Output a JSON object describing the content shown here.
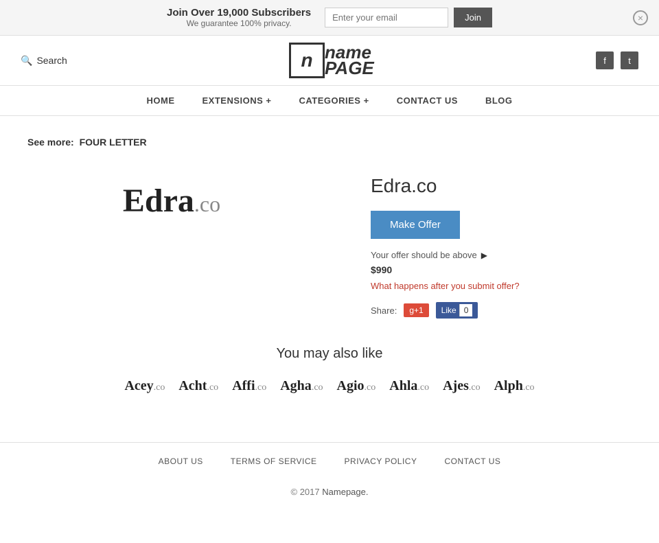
{
  "banner": {
    "main_text": "Join Over 19,000 Subscribers",
    "sub_text": "We guarantee 100% privacy.",
    "email_placeholder": "Enter your email",
    "join_label": "Join",
    "close_icon": "×"
  },
  "header": {
    "search_label": "Search",
    "logo_icon": "n",
    "logo_name": "name",
    "logo_page": "PAGE",
    "facebook_icon": "f",
    "twitter_icon": "t"
  },
  "nav": {
    "items": [
      {
        "label": "HOME",
        "href": "#"
      },
      {
        "label": "EXTENSIONS +",
        "href": "#"
      },
      {
        "label": "CATEGORIES +",
        "href": "#"
      },
      {
        "label": "CONTACT  US",
        "href": "#"
      },
      {
        "label": "BLOG",
        "href": "#"
      }
    ]
  },
  "breadcrumb": {
    "prefix": "See more:",
    "link_label": "FOUR LETTER"
  },
  "domain": {
    "name": "Edra",
    "tld": ".co",
    "full": "Edra.co",
    "make_offer_label": "Make Offer",
    "offer_text": "Your offer should be above",
    "offer_price": "$990",
    "offer_link_text": "What happens after you submit offer?",
    "share_label": "Share:",
    "gplus_label": "g+1",
    "fb_label": "Like",
    "fb_count": "0"
  },
  "also_like": {
    "title": "You may also like",
    "items": [
      {
        "name": "Acey",
        "tld": ".co"
      },
      {
        "name": "Acht",
        "tld": ".co"
      },
      {
        "name": "Affi",
        "tld": ".co"
      },
      {
        "name": "Agha",
        "tld": ".co"
      },
      {
        "name": "Agio",
        "tld": ".co"
      },
      {
        "name": "Ahla",
        "tld": ".co"
      },
      {
        "name": "Ajes",
        "tld": ".co"
      },
      {
        "name": "Alph",
        "tld": ".co"
      }
    ]
  },
  "footer": {
    "links": [
      {
        "label": "ABOUT  US",
        "href": "#"
      },
      {
        "label": "TERMS  OF  SERVICE",
        "href": "#"
      },
      {
        "label": "PRIVACY  POLICY",
        "href": "#"
      },
      {
        "label": "CONTACT  US",
        "href": "#"
      }
    ],
    "copyright": "© 2017",
    "copyright_link": "Namepage."
  }
}
